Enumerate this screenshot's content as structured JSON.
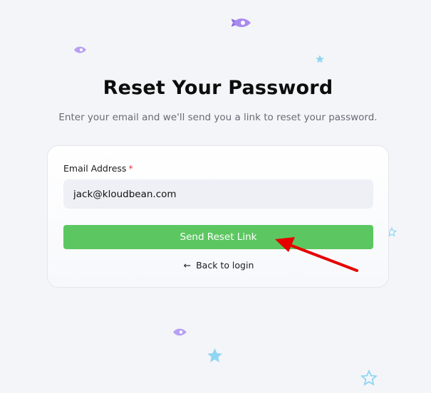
{
  "header": {
    "title": "Reset Your Password",
    "subtitle": "Enter your email and we'll send you a link to reset your password."
  },
  "form": {
    "email_label": "Email Address",
    "required_mark": "*",
    "email_value": "jack@kloudbean.com",
    "submit_label": "Send Reset Link",
    "back_icon": "←",
    "back_label": "Back to login"
  },
  "colors": {
    "accent": "#5cc761",
    "required": "#e23b3b",
    "annotation_arrow": "#e60000",
    "rocket": "#a98af0",
    "star": "#8fd6f3"
  },
  "icons": {
    "decorations": [
      "rocket-icon",
      "star-icon",
      "star-outline-icon"
    ],
    "back": "arrow-left-icon",
    "annotation": "annotation-arrow-icon"
  }
}
